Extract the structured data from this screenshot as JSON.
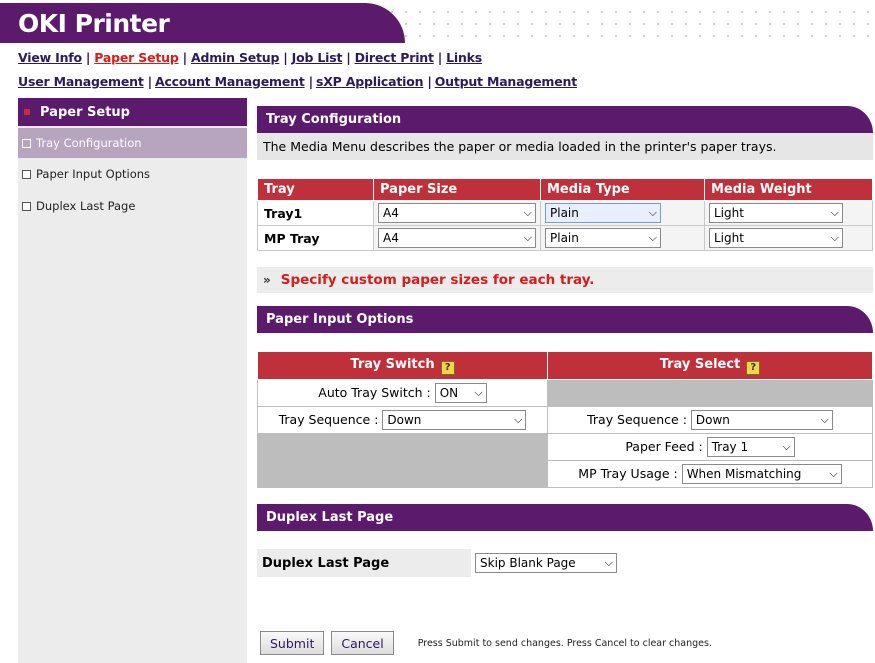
{
  "header": {
    "title": "OKI Printer"
  },
  "nav": {
    "row1": [
      "View Info",
      "Paper Setup",
      "Admin Setup",
      "Job List",
      "Direct Print",
      "Links"
    ],
    "row2": [
      "User Management",
      "Account Management",
      "sXP Application",
      "Output Management"
    ],
    "active": "Paper Setup"
  },
  "sidebar": {
    "title": "Paper Setup",
    "items": [
      {
        "label": "Tray Configuration",
        "selected": true
      },
      {
        "label": "Paper Input Options",
        "selected": false
      },
      {
        "label": "Duplex Last Page",
        "selected": false
      }
    ]
  },
  "tray_config": {
    "heading": "Tray Configuration",
    "description": "The Media Menu describes the paper or media loaded in the printer's paper trays.",
    "columns": [
      "Tray",
      "Paper Size",
      "Media Type",
      "Media Weight"
    ],
    "rows": [
      {
        "tray": "Tray1",
        "paper_size": "A4",
        "media_type": "Plain",
        "media_weight": "Light"
      },
      {
        "tray": "MP Tray",
        "paper_size": "A4",
        "media_type": "Plain",
        "media_weight": "Light"
      }
    ],
    "custom_link": "Specify custom paper sizes for each tray."
  },
  "paper_input": {
    "heading": "Paper Input Options",
    "tray_switch_header": "Tray Switch",
    "tray_select_header": "Tray Select",
    "auto_tray_switch_label": "Auto Tray Switch :",
    "auto_tray_switch_value": "ON",
    "switch_sequence_label": "Tray Sequence :",
    "switch_sequence_value": "Down",
    "select_sequence_label": "Tray Sequence :",
    "select_sequence_value": "Down",
    "paper_feed_label": "Paper Feed :",
    "paper_feed_value": "Tray 1",
    "mp_tray_usage_label": "MP Tray Usage :",
    "mp_tray_usage_value": "When Mismatching"
  },
  "duplex": {
    "heading": "Duplex Last Page",
    "label": "Duplex Last Page",
    "value": "Skip Blank Page"
  },
  "buttons": {
    "submit": "Submit",
    "cancel": "Cancel",
    "hint": "Press Submit to send changes. Press Cancel to clear changes."
  },
  "icons": {
    "help": "help-book-icon",
    "select_arrow": "chevron-down-icon"
  },
  "colors": {
    "brand_purple": "#5b1a6b",
    "table_header_red": "#c0303a",
    "active_link_red": "#d81b1b",
    "sidebar_selected": "#b7a5c0"
  }
}
